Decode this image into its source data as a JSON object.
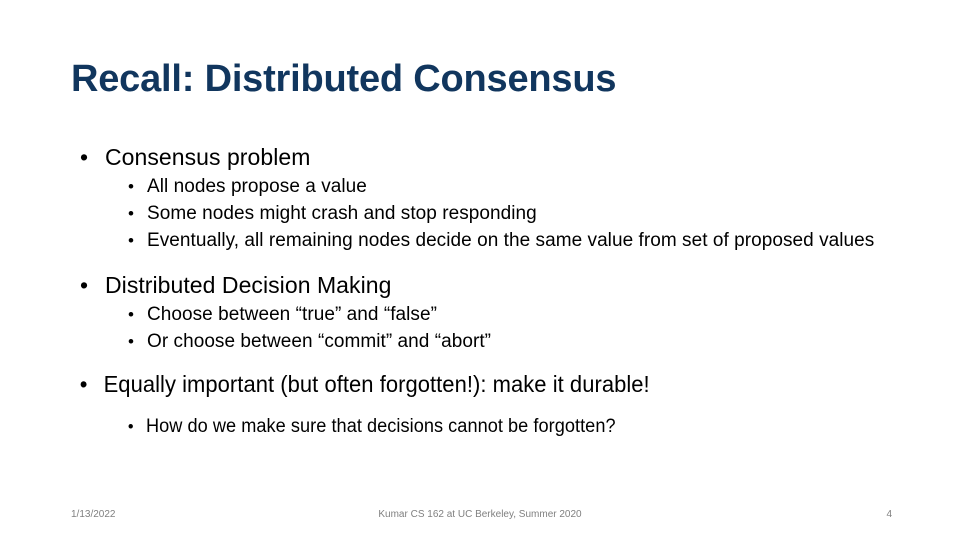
{
  "slide": {
    "title": "Recall: Distributed Consensus",
    "title_color": "#11365E",
    "background_color": "#FFFFFF",
    "body_text_color": "#000000",
    "bullet_glyph": "•"
  },
  "body": {
    "sections": [
      {
        "heading": "Consensus problem",
        "items": [
          "All nodes propose a value",
          "Some nodes might crash and stop responding",
          "Eventually, all remaining nodes decide on the same value from set of proposed values"
        ]
      },
      {
        "heading": "Distributed Decision Making",
        "items": [
          "Choose between “true” and “false”",
          "Or choose between “commit” and “abort”"
        ]
      },
      {
        "heading": "Equally important (but often forgotten!): make it durable!",
        "items": [
          "How do we make sure that decisions cannot be forgotten?"
        ]
      }
    ]
  },
  "footer": {
    "date": "1/13/2022",
    "center": "Kumar CS 162 at UC Berkeley, Summer 2020",
    "page_number": "4",
    "color": "#808080"
  }
}
